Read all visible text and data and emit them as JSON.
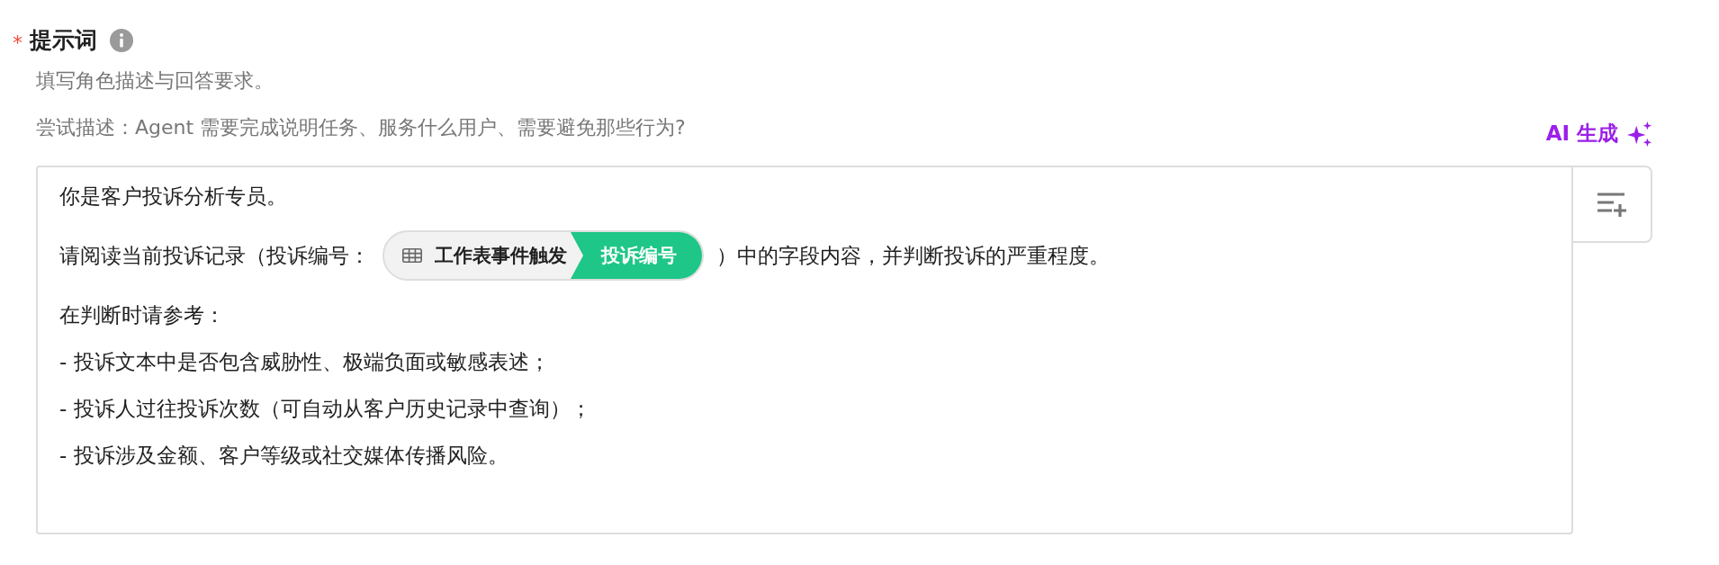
{
  "field": {
    "required_mark": "*",
    "label": "提示词",
    "description": "填写角色描述与回答要求。",
    "hint": "尝试描述：Agent 需要完成说明任务、服务什么用户、需要避免那些行为?",
    "ai_button": "AI 生成"
  },
  "editor": {
    "lines": [
      {
        "kind": "text",
        "text": "你是客户投诉分析专员。"
      },
      {
        "kind": "field",
        "before": "请阅读当前投诉记录（投诉编号：",
        "chip": {
          "source": "工作表事件触发",
          "field": "投诉编号"
        },
        "after": "）中的字段内容，并判断投诉的严重程度。"
      },
      {
        "kind": "text",
        "text": "在判断时请参考："
      },
      {
        "kind": "text",
        "text": "- 投诉文本中是否包含威胁性、极端负面或敏感表述；"
      },
      {
        "kind": "text",
        "text": "- 投诉人过往投诉次数（可自动从客户历史记录中查询）；"
      },
      {
        "kind": "text",
        "text": "- 投诉涉及金额、客户等级或社交媒体传播风险。"
      }
    ]
  }
}
